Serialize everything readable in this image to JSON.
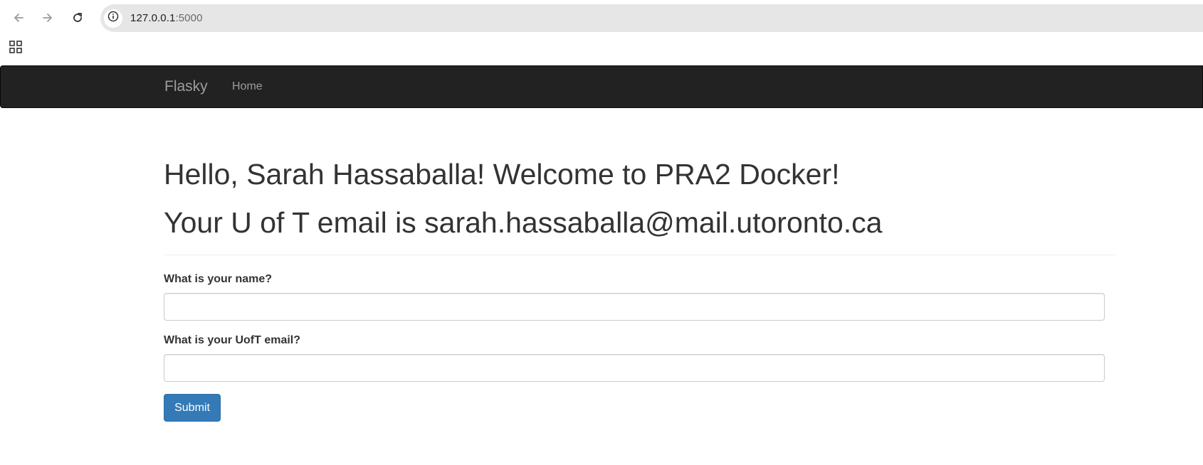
{
  "browser": {
    "back_icon": "arrow-left-icon",
    "forward_icon": "arrow-right-icon",
    "reload_icon": "reload-icon",
    "site_info_icon": "info-icon",
    "url_host": "127.0.0.1",
    "url_port": ":5000",
    "apps_icon": "apps-grid-icon"
  },
  "navbar": {
    "brand": "Flasky",
    "links": [
      {
        "label": "Home"
      }
    ]
  },
  "main": {
    "greeting": "Hello, Sarah Hassaballa! Welcome to PRA2 Docker!",
    "email_message": "Your U of T email is sarah.hassaballa@mail.utoronto.ca",
    "form": {
      "name_label": "What is your name?",
      "name_value": "",
      "email_label": "What is your UofT email?",
      "email_value": "",
      "submit_label": "Submit"
    }
  },
  "colors": {
    "navbar_bg": "#222222",
    "navbar_text": "#9d9d9d",
    "primary_button": "#337ab7",
    "omnibox_bg": "#e6e6e6"
  }
}
